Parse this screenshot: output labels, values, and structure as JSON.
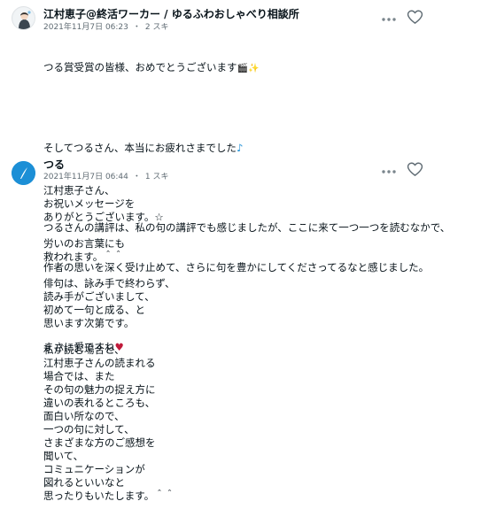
{
  "comments": [
    {
      "author": "江村恵子@終活ワーカー / ゆるふわおしゃべり相談所",
      "date": "2021年11月7日 06:23",
      "likes": "2 スキ",
      "lines": [
        "つる賞受賞の皆様、おめでとうございます",
        "",
        "そしてつるさん、本当にお疲れさまでした",
        "",
        "つるさんの講評は、私の句の講評でも感じましたが、ここに来て一つ一つを読むなかで、",
        "作者の思いを深く受け止めて、さらに句を豊かにしてくださってるなと感じました。",
        "",
        "まさに愛ですね"
      ],
      "emoji_line0": [
        "🎬",
        "✨"
      ],
      "emoji_line2": "♪",
      "emoji_line7": "♥"
    },
    {
      "author": "つる",
      "date": "2021年11月7日 06:44",
      "likes": "1 スキ",
      "lines": [
        "江村恵子さん、",
        "お祝いメッセージを",
        "ありがとうございます。☆",
        "",
        "労いのお言葉にも",
        "救われます。＾＾",
        "",
        "俳句は、詠み手で終わらず、",
        "読み手がございまして、",
        "初めて一句と成る、と",
        "思います次第です。",
        "",
        "私が読む場合と、",
        "江村恵子さんの読まれる",
        "場合では、また",
        "その句の魅力の捉え方に",
        "違いの表れるところも、",
        "面白い所なので、",
        "一つの句に対して、",
        "さまざまな方のご感想を",
        "聞いて、",
        "コミュニケーションが",
        "図れるといいなと",
        "思ったりもいたします。＾＾"
      ]
    }
  ],
  "separator": "・",
  "icons": {
    "more": "more-options-icon",
    "like": "heart-outline-icon",
    "avatar_color": "#1c8fd6",
    "heart_color": "#c01a3a"
  }
}
